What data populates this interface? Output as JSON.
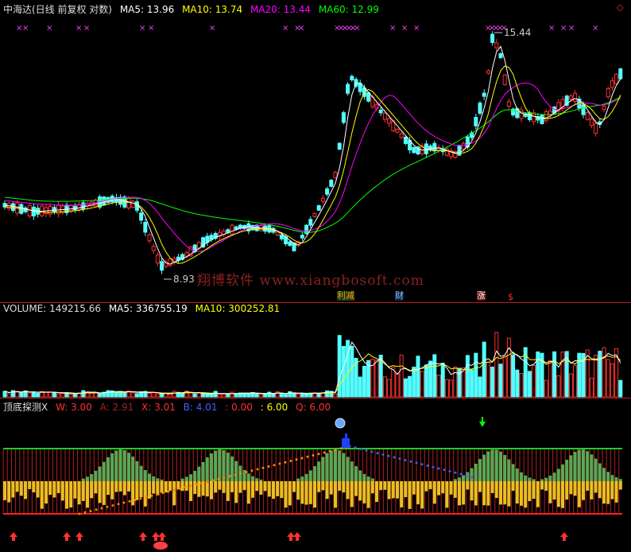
{
  "main_header": {
    "title": "中海达(日线 前复权 对数)",
    "ma5": "MA5: 13.96",
    "ma10": "MA10: 13.74",
    "ma20": "MA20: 13.44",
    "ma60": "MA60: 12.99"
  },
  "volume_header": {
    "title": "VOLUME: 149215.66",
    "ma5": "MA5: 336755.19",
    "ma10": "MA10: 300252.81"
  },
  "indicator_header": {
    "title": "顶底探测X",
    "w": "W: 3.00",
    "a": "A: 2.91",
    "x": "X: 3.01",
    "b": "B: 4.01",
    "c": ": 0.00",
    "d": ": 6.00",
    "q": "Q: 6.00"
  },
  "price_labels": {
    "high": "15.44",
    "low": "8.93"
  },
  "watermark": "翔博软件 www.xiangbosoft.com",
  "event_badges": {
    "b1": "利减",
    "b2": "财",
    "b3": "涨",
    "b4": "$"
  },
  "colors": {
    "up": "#ff3030",
    "down": "#54ffff",
    "ma5": "#ffffff",
    "ma10": "#ffff00",
    "ma20": "#ff00ff",
    "ma60": "#00ff00",
    "border": "#b22222"
  },
  "chart_data": {
    "type": "candlestick",
    "price_range": [
      8.93,
      15.44
    ],
    "series": [
      "MA5",
      "MA10",
      "MA20",
      "MA60",
      "VOLUME",
      "MA5",
      "MA10"
    ]
  }
}
